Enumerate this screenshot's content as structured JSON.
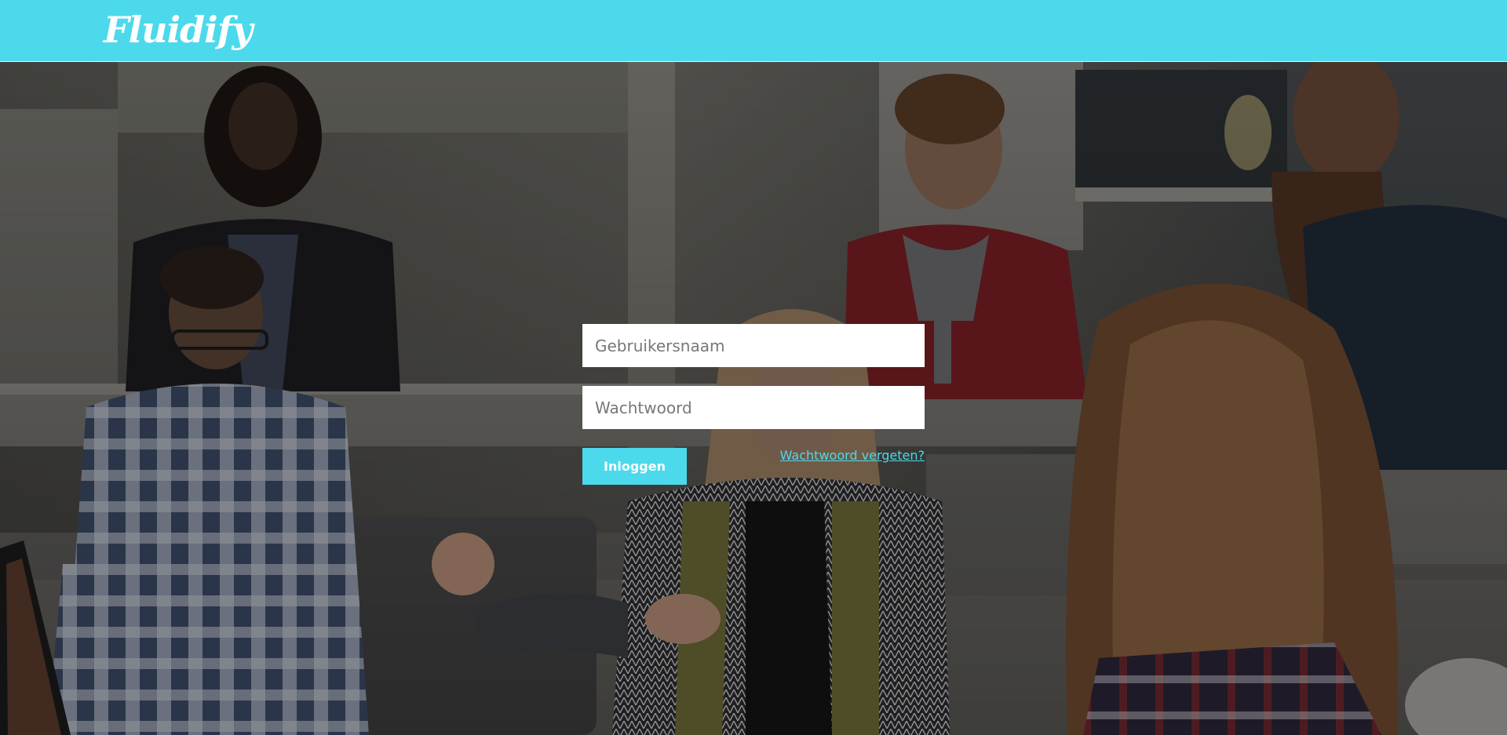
{
  "brand": {
    "logo_text": "Fluidify",
    "accent_color": "#4cd9eb"
  },
  "login": {
    "username_placeholder": "Gebruikersnaam",
    "password_placeholder": "Wachtwoord",
    "submit_label": "Inloggen",
    "forgot_label": "Wachtwoord vergeten?"
  }
}
